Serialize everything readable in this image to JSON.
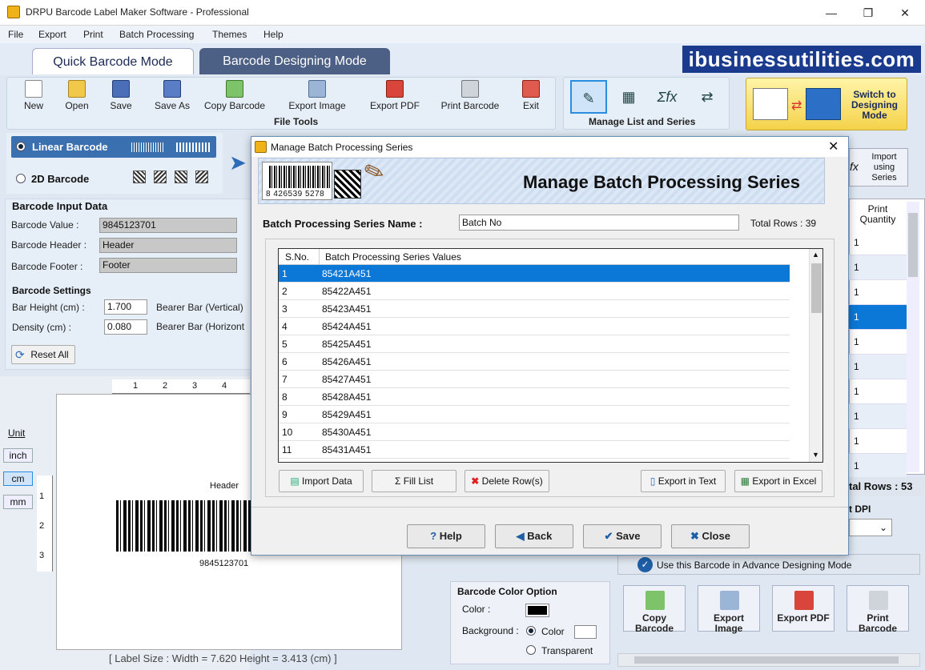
{
  "window": {
    "title": "DRPU Barcode Label Maker Software - Professional",
    "minimize": "—",
    "maximize": "❐",
    "close": "✕"
  },
  "menu": [
    "File",
    "Export",
    "Print",
    "Batch Processing",
    "Themes",
    "Help"
  ],
  "tabs": {
    "quick": "Quick Barcode Mode",
    "design": "Barcode Designing Mode"
  },
  "brand": "ibusinessutilities.com",
  "toolbar": {
    "items": [
      "New",
      "Open",
      "Save",
      "Save As",
      "Copy Barcode",
      "Export Image",
      "Export PDF",
      "Print Barcode",
      "Exit"
    ],
    "group_label": "File Tools",
    "list_group_label": "Manage List and Series",
    "switch_label": "Switch to Designing Mode"
  },
  "barcode_type": {
    "linear": "Linear Barcode",
    "twod": "2D Barcode"
  },
  "input": {
    "header": "Barcode Input Data",
    "value_label": "Barcode Value :",
    "value": "9845123701",
    "header_label": "Barcode Header :",
    "header_value": "Header",
    "footer_label": "Barcode Footer :",
    "footer_value": "Footer"
  },
  "settings": {
    "header": "Barcode Settings",
    "bar_height_label": "Bar Height (cm) :",
    "bar_height": "1.700",
    "density_label": "Density (cm) :",
    "density": "0.080",
    "bearer_v": "Bearer Bar (Vertical)",
    "bearer_h": "Bearer Bar (Horizont",
    "reset": "Reset All"
  },
  "canvas": {
    "unit_label": "Unit",
    "units": [
      "inch",
      "cm",
      "mm"
    ],
    "ruler_top": [
      "1",
      "2",
      "3",
      "4"
    ],
    "ruler_left": [
      "1",
      "2",
      "3"
    ],
    "barcode_header": "Header",
    "barcode_value": "9845123701",
    "status": "[ Label Size : Width = 7.620  Height = 3.413 (cm) ]"
  },
  "right": {
    "import_series": "Import using Series",
    "print_quantity_header": "Print Quantity",
    "quantities": [
      "1",
      "1",
      "1",
      "1",
      "1",
      "1",
      "1",
      "1",
      "1",
      "1"
    ],
    "total_rows": "tal Rows : 53",
    "dpi_label": "t DPI",
    "use_in_advance": "Use this Barcode in Advance Designing Mode"
  },
  "color_option": {
    "header": "Barcode Color Option",
    "color_label": "Color :",
    "background_label": "Background :",
    "bg_color": "Color",
    "bg_transparent": "Transparent"
  },
  "bottom_buttons": [
    "Copy Barcode",
    "Export Image",
    "Export PDF",
    "Print Barcode"
  ],
  "dialog": {
    "title": "Manage Batch Processing Series",
    "banner_title": "Manage Batch Processing Series",
    "banner_digits": "8 426539 5278",
    "series_name_label": "Batch Processing Series Name :",
    "series_name_value": "Batch No",
    "total_rows": "Total Rows : 39",
    "col_sno": "S.No.",
    "col_values": "Batch Processing Series Values",
    "rows": [
      {
        "sn": "1",
        "val": "85421A451"
      },
      {
        "sn": "2",
        "val": "85422A451"
      },
      {
        "sn": "3",
        "val": "85423A451"
      },
      {
        "sn": "4",
        "val": "85424A451"
      },
      {
        "sn": "5",
        "val": "85425A451"
      },
      {
        "sn": "6",
        "val": "85426A451"
      },
      {
        "sn": "7",
        "val": "85427A451"
      },
      {
        "sn": "8",
        "val": "85428A451"
      },
      {
        "sn": "9",
        "val": "85429A451"
      },
      {
        "sn": "10",
        "val": "85430A451"
      },
      {
        "sn": "11",
        "val": "85431A451"
      }
    ],
    "buttons": {
      "import": "Import Data",
      "fill": "Fill List",
      "delete": "Delete Row(s)",
      "export_text": "Export in Text",
      "export_excel": "Export in Excel",
      "help": "Help",
      "back": "Back",
      "save": "Save",
      "close": "Close"
    }
  },
  "colors": {
    "selection": "#0b78d7",
    "brand_bg": "#1a3a8e",
    "tab_active_bg": "#4c5f84"
  }
}
